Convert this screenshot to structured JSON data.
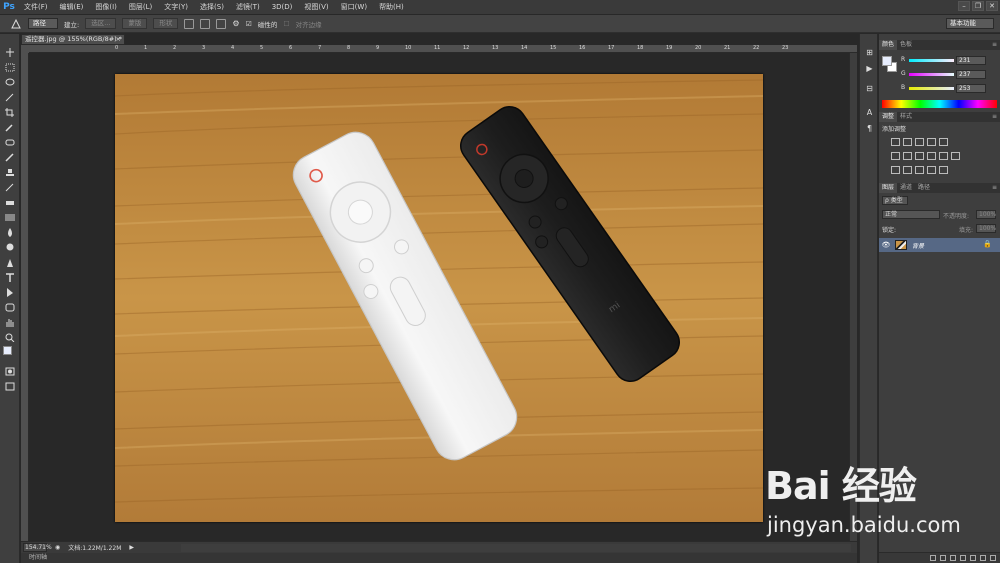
{
  "app": {
    "logo": "Ps",
    "menu": [
      "文件(F)",
      "编辑(E)",
      "图像(I)",
      "图层(L)",
      "文字(Y)",
      "选择(S)",
      "滤镜(T)",
      "3D(D)",
      "视图(V)",
      "窗口(W)",
      "帮助(H)"
    ],
    "window_controls": [
      "–",
      "❐",
      "✕"
    ]
  },
  "options_bar": {
    "mode": "路径",
    "make_label": "建立:",
    "selection_btn": "选区...",
    "mask_btn": "蒙版",
    "shape_btn": "形状",
    "magnetic_label": "磁性的",
    "align_edges_label": "对齐边缘",
    "workspace": "基本功能"
  },
  "document": {
    "tab_title": "遥控器.jpg @ 155%(RGB/8#) *",
    "close": "×",
    "ruler_numbers": [
      "0",
      "1",
      "2",
      "3",
      "4",
      "5",
      "6",
      "7",
      "8",
      "9",
      "10",
      "11",
      "12",
      "13",
      "14",
      "15",
      "16",
      "17",
      "18",
      "19",
      "20",
      "21",
      "22",
      "23"
    ],
    "zoom": "154.71%",
    "doc_info": "文档:1.22M/1.22M",
    "timeline_label": "时间轴"
  },
  "color_panel": {
    "tabs": [
      "颜色",
      "色板"
    ],
    "channels": [
      {
        "label": "R",
        "value": "231"
      },
      {
        "label": "G",
        "value": "237"
      },
      {
        "label": "B",
        "value": "253"
      }
    ]
  },
  "adjustments_panel": {
    "tabs": [
      "调整",
      "样式"
    ],
    "title": "添加调整"
  },
  "layers_panel": {
    "tabs": [
      "图层",
      "通道",
      "路径"
    ],
    "kind_filter": "ρ 类型",
    "blend_mode": "正常",
    "opacity_label": "不透明度:",
    "opacity_value": "100%",
    "lock_label": "锁定:",
    "fill_label": "填充:",
    "fill_value": "100%",
    "layer_name": "背景"
  },
  "watermark": {
    "brand": "Bai 经验",
    "url": "jingyan.baidu.com"
  },
  "colors": {
    "wood": "#c99548",
    "remote_white": "#f3f3f3",
    "remote_black": "#1f1f1f",
    "selected_layer": "#566885"
  }
}
